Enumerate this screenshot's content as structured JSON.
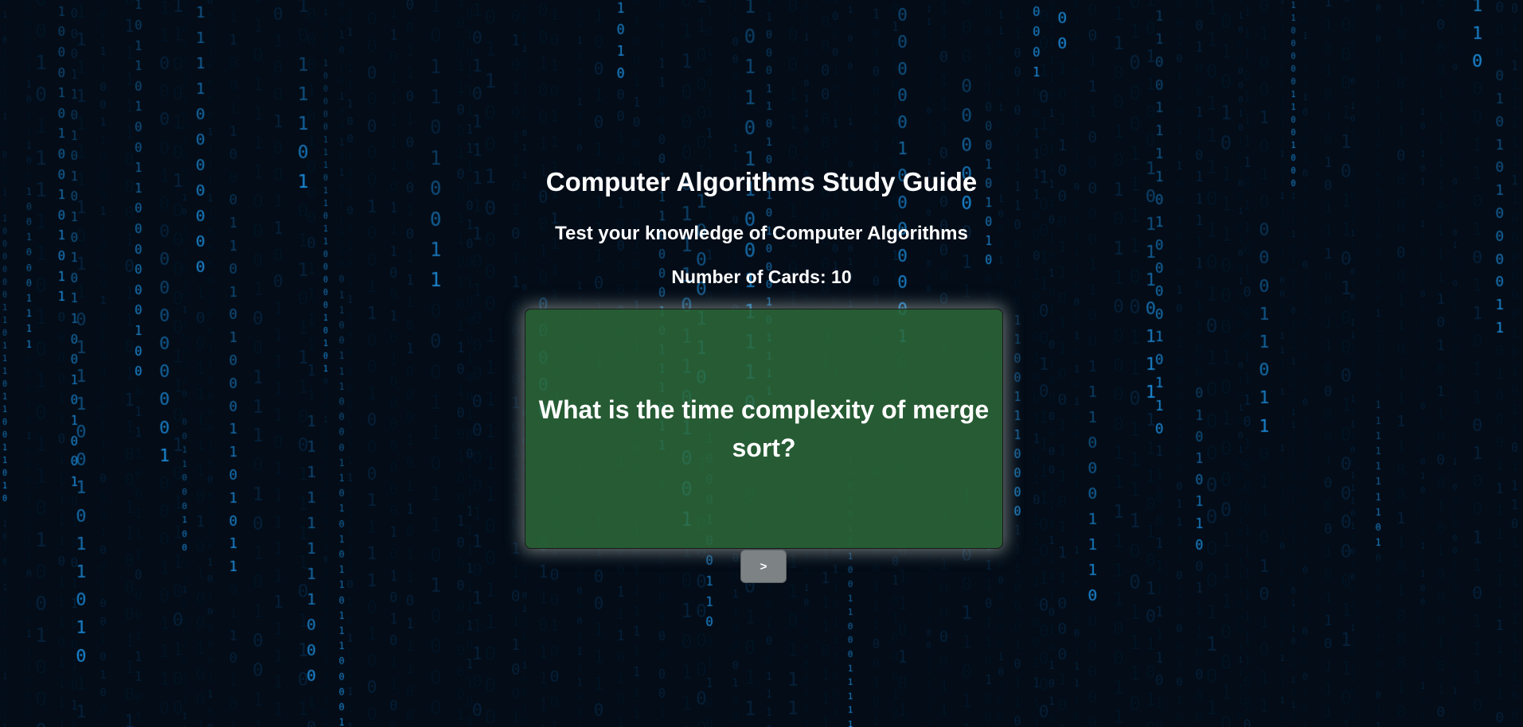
{
  "header": {
    "title": "Computer Algorithms Study Guide",
    "subtitle": "Test your knowledge of Computer Algorithms",
    "card_count_label": "Number of Cards: 10"
  },
  "flashcard": {
    "question": "What is the time complexity of merge sort?"
  },
  "controls": {
    "next_label": ">"
  },
  "background": {
    "style": "binary digital rain",
    "glyphs": [
      "0",
      "1"
    ]
  },
  "colors": {
    "page_background": "#030c17",
    "rain_bright": "#1e90e0",
    "rain_dim": "#0e3f66",
    "card_background": "#2c6938",
    "card_glow": "#bec8be",
    "button_background": "#7d8284",
    "text": "#ffffff"
  }
}
